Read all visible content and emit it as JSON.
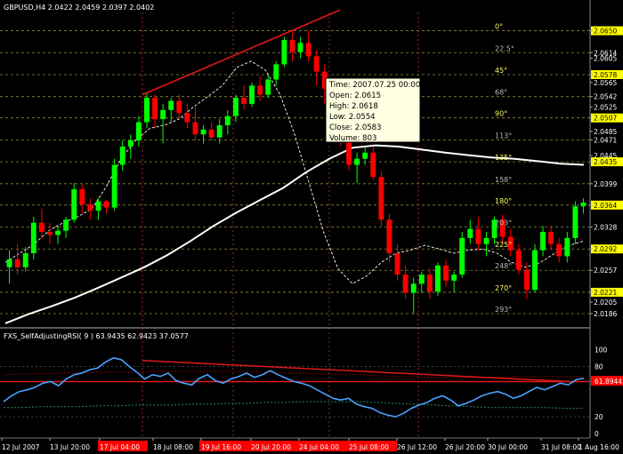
{
  "header": {
    "symbol_line": "GBPUSD,H4  2.0422 2.0459 2.0397 2.0402"
  },
  "indicator": {
    "label": "FXS_SelfAdjustingRSI( 9 ) 63.9435 62.9423 37.0577",
    "badge": "61.8944",
    "ticks": [
      "100",
      "80",
      "20",
      "0"
    ]
  },
  "tooltip": {
    "lines": [
      "Time: 2007.07.25 00:00",
      "Open: 2.0615",
      "High: 2.0618",
      "Low: 2.0554",
      "Close: 2.0583",
      "Volume: 803"
    ]
  },
  "fib_levels": [
    {
      "label": "0°",
      "value": 2.065
    },
    {
      "label": "22.5°",
      "value": 2.0614
    },
    {
      "label": "45°",
      "value": 2.0578
    },
    {
      "label": "68°",
      "value": 2.0542
    },
    {
      "label": "90°",
      "value": 2.0507
    },
    {
      "label": "113°",
      "value": 2.0471
    },
    {
      "label": "135°",
      "value": 2.0435
    },
    {
      "label": "158°",
      "value": 2.0399
    },
    {
      "label": "180°",
      "value": 2.0364
    },
    {
      "label": "203°",
      "value": 2.0328
    },
    {
      "label": "225°",
      "value": 2.0292
    },
    {
      "label": "248°",
      "value": 2.0257
    },
    {
      "label": "270°",
      "value": 2.0221
    },
    {
      "label": "293°",
      "value": 2.0186
    }
  ],
  "colors": {
    "bull": "#00ff00",
    "bear": "#ff0000",
    "trendline": "#e01818",
    "rsi": "#4aa3ff",
    "band_upper": "#8b0000",
    "band_lower": "#2e8b57",
    "ma": "#ffffff",
    "fib_text": "#ffff66",
    "grid": "#333333"
  },
  "chart_data": {
    "type": "candlestick",
    "symbol": "GBPUSD",
    "timeframe": "H4",
    "ylim": [
      2.0167,
      2.068
    ],
    "y_ticks": [
      "2.0650",
      "2.0614",
      "2.0605",
      "2.0578",
      "2.0565",
      "2.0542",
      "2.0525",
      "2.0507",
      "2.0485",
      "2.0471",
      "2.0445",
      "2.0435",
      "2.0399",
      "2.0364",
      "2.0328",
      "2.0292",
      "2.0257",
      "2.0221",
      "2.0205",
      "2.0186"
    ],
    "highlighted_ticks": [
      "2.0650",
      "2.0578",
      "2.0507",
      "2.0435",
      "2.0364",
      "2.0292",
      "2.0221"
    ],
    "x_labels": [
      "12 Jul 2007",
      "13 Jul 20:00",
      "17 Jul 04:00",
      "18 Jul 08:00",
      "19 Jul 16:00",
      "20 Jul 20:00",
      "24 Jul 04:00",
      "25 Jul 08:00",
      "26 Jul 12:00",
      "26 Jul 20:00",
      "30 Jul 00:00",
      "31 Jul 08:00",
      "1 Aug 16:00"
    ],
    "x_label_flags": [
      false,
      false,
      true,
      false,
      true,
      true,
      true,
      true,
      false,
      false,
      false,
      false,
      false
    ],
    "candles": [
      [
        2.0262,
        2.029,
        2.0235,
        2.0275
      ],
      [
        2.0275,
        2.03,
        2.025,
        2.0262
      ],
      [
        2.0262,
        2.0295,
        2.0255,
        2.0285
      ],
      [
        2.0285,
        2.0345,
        2.0275,
        2.0335
      ],
      [
        2.0335,
        2.0358,
        2.031,
        2.032
      ],
      [
        2.032,
        2.0335,
        2.03,
        2.0315
      ],
      [
        2.0315,
        2.033,
        2.03,
        2.0322
      ],
      [
        2.0322,
        2.0345,
        2.031,
        2.034
      ],
      [
        2.034,
        2.04,
        2.0335,
        2.039
      ],
      [
        2.039,
        2.0398,
        2.035,
        2.0365
      ],
      [
        2.0365,
        2.0375,
        2.034,
        2.0355
      ],
      [
        2.0355,
        2.0375,
        2.034,
        2.037
      ],
      [
        2.037,
        2.0372,
        2.035,
        2.036
      ],
      [
        2.036,
        2.044,
        2.0355,
        2.043
      ],
      [
        2.043,
        2.047,
        2.042,
        2.046
      ],
      [
        2.046,
        2.048,
        2.044,
        2.047
      ],
      [
        2.047,
        2.051,
        2.046,
        2.05
      ],
      [
        2.05,
        2.0548,
        2.049,
        2.054
      ],
      [
        2.054,
        2.0545,
        2.049,
        2.0505
      ],
      [
        2.0505,
        2.053,
        2.0465,
        2.052
      ],
      [
        2.052,
        2.054,
        2.05,
        2.0535
      ],
      [
        2.0535,
        2.0545,
        2.0505,
        2.0515
      ],
      [
        2.0515,
        2.053,
        2.049,
        2.05
      ],
      [
        2.05,
        2.0525,
        2.047,
        2.048
      ],
      [
        2.048,
        2.0495,
        2.0465,
        2.0488
      ],
      [
        2.0488,
        2.05,
        2.047,
        2.0475
      ],
      [
        2.0475,
        2.0505,
        2.0465,
        2.0495
      ],
      [
        2.0495,
        2.052,
        2.048,
        2.051
      ],
      [
        2.051,
        2.0545,
        2.05,
        2.054
      ],
      [
        2.054,
        2.056,
        2.052,
        2.053
      ],
      [
        2.053,
        2.0565,
        2.0525,
        2.056
      ],
      [
        2.056,
        2.0575,
        2.0535,
        2.0545
      ],
      [
        2.0545,
        2.0578,
        2.054,
        2.057
      ],
      [
        2.057,
        2.06,
        2.056,
        2.0595
      ],
      [
        2.0595,
        2.064,
        2.059,
        2.0635
      ],
      [
        2.0635,
        2.065,
        2.06,
        2.0615
      ],
      [
        2.0615,
        2.064,
        2.0605,
        2.063
      ],
      [
        2.063,
        2.065,
        2.06,
        2.0608
      ],
      [
        2.0608,
        2.0618,
        2.056,
        2.0583
      ],
      [
        2.0583,
        2.0595,
        2.053,
        2.0555
      ],
      [
        2.0555,
        2.0565,
        2.05,
        2.051
      ],
      [
        2.051,
        2.052,
        2.046,
        2.047
      ],
      [
        2.047,
        2.048,
        2.042,
        2.043
      ],
      [
        2.043,
        2.045,
        2.04,
        2.044
      ],
      [
        2.044,
        2.046,
        2.043,
        2.045
      ],
      [
        2.045,
        2.046,
        2.0405,
        2.041
      ],
      [
        2.041,
        2.042,
        2.033,
        2.034
      ],
      [
        2.034,
        2.035,
        2.027,
        2.0285
      ],
      [
        2.0285,
        2.03,
        2.024,
        2.025
      ],
      [
        2.025,
        2.0265,
        2.021,
        2.022
      ],
      [
        2.022,
        2.0245,
        2.0185,
        2.0235
      ],
      [
        2.0235,
        2.0255,
        2.022,
        2.025
      ],
      [
        2.025,
        2.026,
        2.021,
        2.0222
      ],
      [
        2.0222,
        2.027,
        2.0215,
        2.0265
      ],
      [
        2.0265,
        2.0275,
        2.023,
        2.024
      ],
      [
        2.024,
        2.0255,
        2.022,
        2.025
      ],
      [
        2.025,
        2.032,
        2.0245,
        2.031
      ],
      [
        2.031,
        2.034,
        2.03,
        2.0325
      ],
      [
        2.0325,
        2.0345,
        2.029,
        2.03
      ],
      [
        2.03,
        2.032,
        2.028,
        2.031
      ],
      [
        2.031,
        2.0345,
        2.03,
        2.034
      ],
      [
        2.034,
        2.0348,
        2.03,
        2.0312
      ],
      [
        2.0312,
        2.0325,
        2.028,
        2.029
      ],
      [
        2.029,
        2.03,
        2.025,
        2.0258
      ],
      [
        2.0258,
        2.027,
        2.021,
        2.0225
      ],
      [
        2.0225,
        2.03,
        2.022,
        2.029
      ],
      [
        2.029,
        2.033,
        2.028,
        2.032
      ],
      [
        2.032,
        2.033,
        2.029,
        2.03
      ],
      [
        2.03,
        2.031,
        2.027,
        2.028
      ],
      [
        2.028,
        2.032,
        2.027,
        2.031
      ],
      [
        2.031,
        2.037,
        2.03,
        2.0362
      ],
      [
        2.0362,
        2.0375,
        2.035,
        2.0368
      ]
    ],
    "ma_slow": [
      2.017,
      2.0185,
      2.0198,
      2.0212,
      2.0228,
      2.0245,
      2.0262,
      2.0282,
      2.0305,
      2.033,
      2.0352,
      2.0372,
      2.0392,
      2.0418,
      2.044,
      2.0458,
      2.0462,
      2.046,
      2.0455,
      2.045,
      2.0446,
      2.0442,
      2.044,
      2.0436,
      2.0432,
      2.043
    ],
    "ma_fast": [
      2.027,
      2.0285,
      2.03,
      2.0322,
      2.0335,
      2.0345,
      2.0358,
      2.0395,
      2.044,
      2.047,
      2.049,
      2.0495,
      2.0505,
      2.0525,
      2.0542,
      2.056,
      2.059,
      2.06,
      2.0585,
      2.0545,
      2.048,
      2.04,
      2.032,
      2.026,
      2.0235,
      2.0248,
      2.027,
      2.0285,
      2.029,
      2.0298,
      2.0292,
      2.0285,
      2.029,
      2.0292,
      2.0285,
      2.027,
      2.0262,
      2.027,
      2.0285,
      2.0298,
      2.0305
    ],
    "price_trendline": [
      [
        2.0545,
        2.0684
      ]
    ],
    "rsi": [
      38,
      45,
      50,
      52,
      55,
      60,
      62,
      57,
      65,
      70,
      72,
      76,
      78,
      85,
      90,
      88,
      80,
      73,
      65,
      70,
      68,
      72,
      63,
      60,
      58,
      66,
      70,
      63,
      60,
      65,
      68,
      72,
      67,
      70,
      75,
      70,
      66,
      62,
      60,
      57,
      52,
      47,
      42,
      40,
      42,
      35,
      32,
      30,
      25,
      22,
      20,
      24,
      30,
      34,
      37,
      42,
      45,
      40,
      33,
      36,
      40,
      45,
      48,
      50,
      47,
      42,
      45,
      50,
      55,
      52,
      56,
      60,
      58,
      64,
      66
    ],
    "rsi_upper": [
      70,
      71,
      71,
      72,
      72,
      73,
      73,
      73,
      74,
      74,
      74,
      74,
      74,
      74,
      73,
      72,
      72,
      71,
      70,
      70,
      69,
      68,
      68,
      67,
      67,
      67,
      67,
      67,
      68,
      68,
      68,
      68
    ],
    "rsi_lower": [
      31,
      31,
      32,
      32,
      32,
      33,
      33,
      34,
      34,
      34,
      35,
      35,
      36,
      36,
      37,
      37,
      38,
      38,
      38,
      38,
      37,
      36,
      35,
      34,
      33,
      32,
      31,
      31,
      31,
      31,
      30,
      30
    ],
    "rsi_ylim": [
      0,
      110
    ],
    "rsi_level": 61.8944
  }
}
